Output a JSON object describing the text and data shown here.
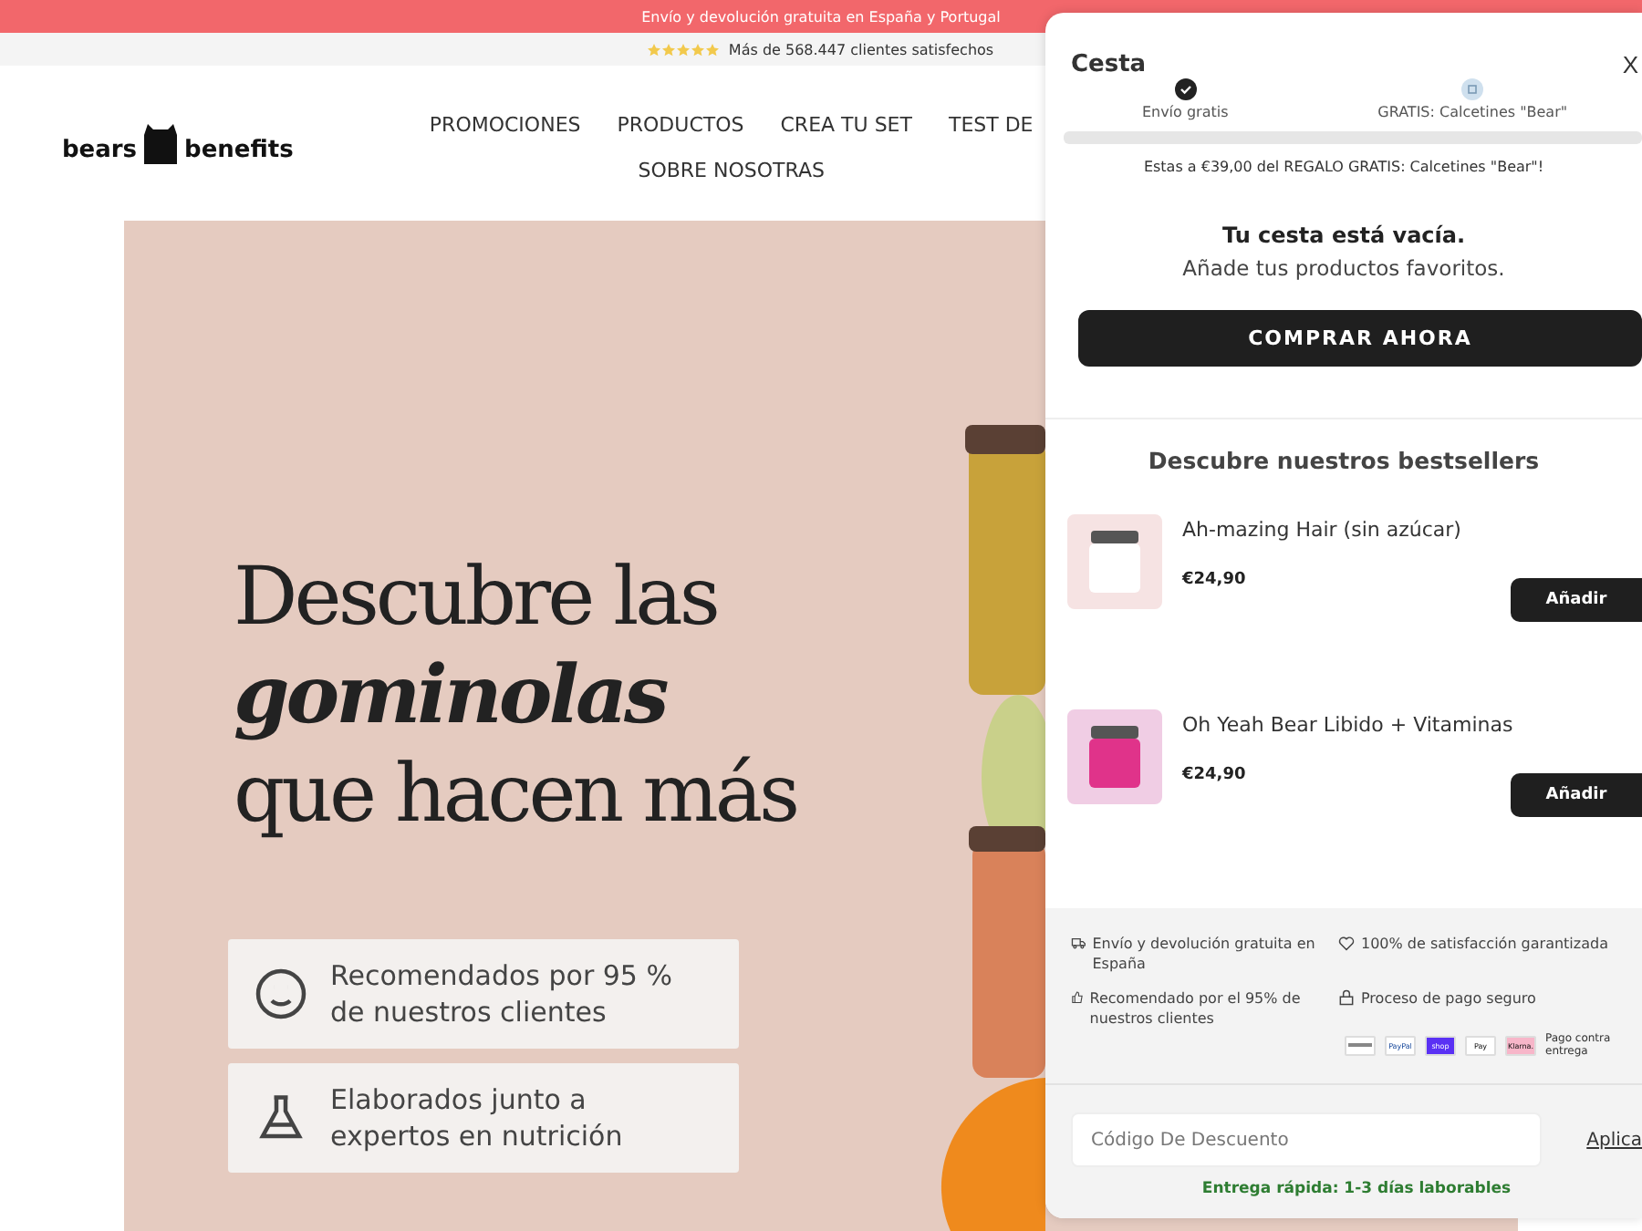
{
  "announcement": "Envío y devolución gratuita en España y Portugal",
  "rating_bar": {
    "stars": 5,
    "text": "Más de 568.447 clientes satisfechos"
  },
  "logo": {
    "left": "bears",
    "right": "benefits"
  },
  "nav": [
    {
      "label": "PROMOCIONES"
    },
    {
      "label": "PRODUCTOS"
    },
    {
      "label": "CREA TU SET"
    },
    {
      "label": "TEST DE"
    },
    {
      "label": "SOBRE NOSOTRAS"
    }
  ],
  "hero": {
    "headline": [
      {
        "text": "Descubre las",
        "emphasis": false
      },
      {
        "text": "gominolas",
        "emphasis": true
      },
      {
        "text": "que hacen más",
        "emphasis": false
      }
    ],
    "features": [
      {
        "kind": "smile",
        "text": "Recomendados por 95 % de nuestros clientes"
      },
      {
        "kind": "flask",
        "text": "Elaborados junto a expertos en nutrición"
      }
    ]
  },
  "cart": {
    "title": "Cesta",
    "close": "X",
    "milestones": [
      {
        "label": "Envío gratis",
        "reached": true
      },
      {
        "label": "GRATIS: Calcetines \"Bear\"",
        "reached": false
      }
    ],
    "progress_message": "Estas a €39,00 del REGALO GRATIS: Calcetines \"Bear\"!",
    "empty_title": "Tu cesta está vacía.",
    "empty_subtitle": "Añade tus productos favoritos.",
    "cta": "COMPRAR AHORA",
    "bestsellers_title": "Descubre nuestros bestsellers",
    "products": [
      {
        "name": "Ah-mazing Hair (sin azúcar)",
        "price": "€24,90",
        "button": "Añadir",
        "color": "#f6e3e3"
      },
      {
        "name": "Oh Yeah Bear Libido + Vitaminas",
        "price": "€24,90",
        "button": "Añadir",
        "color": "#f0cde4"
      }
    ],
    "benefits": [
      {
        "kind": "truck",
        "text": "Envío y devolución gratuita en España"
      },
      {
        "kind": "heart",
        "text": "100% de satisfacción garantizada"
      },
      {
        "kind": "thumb",
        "text": "Recomendado por el 95% de nuestros clientes"
      },
      {
        "kind": "lock",
        "text": "Proceso de pago seguro"
      }
    ],
    "payments": [
      {
        "kind": "card"
      },
      {
        "kind": "paypal",
        "label": "PayPal"
      },
      {
        "kind": "shop",
        "label": "shop"
      },
      {
        "kind": "applepay",
        "label": "Pay"
      },
      {
        "kind": "klarna",
        "label": "Klarna."
      },
      {
        "kind": "text",
        "label": "Pago contra entrega"
      }
    ],
    "discount_placeholder": "Código De Descuento",
    "apply": "Aplica",
    "delivery_note": "Entrega rápida: 1-3 días laborables"
  }
}
